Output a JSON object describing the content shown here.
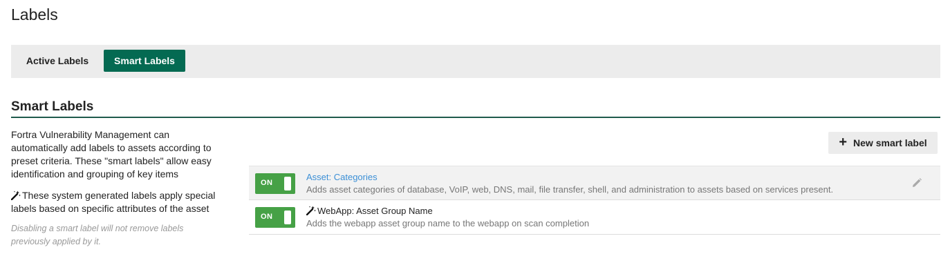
{
  "page": {
    "title": "Labels"
  },
  "tabs": [
    {
      "label": "Active Labels",
      "active": false
    },
    {
      "label": "Smart Labels",
      "active": true
    }
  ],
  "section": {
    "title": "Smart Labels",
    "description": "Fortra Vulnerability Management can automatically add labels to assets according to preset criteria. These \"smart labels\" allow easy identification and grouping of key items",
    "wand_note": "These system generated labels apply special labels based on specific attributes of the asset",
    "disable_note": "Disabling a smart label will not remove labels previously applied by it."
  },
  "actions": {
    "new_smart_label": "New smart label"
  },
  "smart_labels": [
    {
      "toggle": "ON",
      "title": "Asset: Categories",
      "system_generated": false,
      "description": "Adds asset categories of database, VoIP, web, DNS, mail, file transfer, shell, and administration to assets based on services present."
    },
    {
      "toggle": "ON",
      "title": "WebApp: Asset Group Name",
      "system_generated": true,
      "description": "Adds the webapp asset group name to the webapp on scan completion"
    }
  ],
  "colors": {
    "accent": "#046a52",
    "toggle_on": "#46a146",
    "link": "#3b8fd6"
  },
  "icons": [
    "magic-wand-icon",
    "plus-icon",
    "pencil-icon"
  ]
}
